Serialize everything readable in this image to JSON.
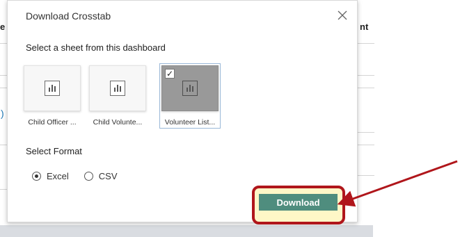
{
  "background": {
    "left_fragment": "e",
    "right_fragment": "nt",
    "blue_fragment": ")"
  },
  "dialog": {
    "title": "Download Crosstab",
    "sheet_prompt": "Select a sheet from this dashboard",
    "sheets": [
      {
        "name": "Child Officer ...",
        "selected": false
      },
      {
        "name": "Child Volunte...",
        "selected": false
      },
      {
        "name": "Volunteer List...",
        "selected": true
      }
    ],
    "format_label": "Select Format",
    "formats": [
      {
        "label": "Excel",
        "checked": true
      },
      {
        "label": "CSV",
        "checked": false
      }
    ],
    "download_label": "Download"
  },
  "icons": {
    "close": "close-icon",
    "sheet": "bar-chart-icon",
    "check": "checkmark-icon"
  },
  "colors": {
    "download_button": "#4f8d7e",
    "highlight_border": "#b0161b",
    "highlight_fill": "#fef7c7",
    "arrow": "#b0161b",
    "selected_thumb": "#999999"
  }
}
